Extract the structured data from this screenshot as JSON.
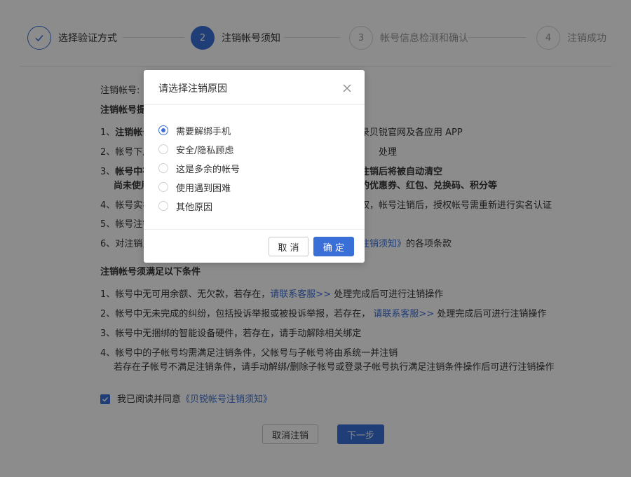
{
  "stepper": {
    "steps": [
      {
        "label": "选择验证方式"
      },
      {
        "number": "2",
        "label": "注销帐号须知"
      },
      {
        "number": "3",
        "label": "帐号信息检测和确认"
      },
      {
        "number": "4",
        "label": "注销成功"
      }
    ]
  },
  "account": {
    "label": "注销帐号:"
  },
  "section1": {
    "title": "注销帐号提",
    "items": [
      {
        "num": "1、",
        "bold": "注销帐号",
        "tail": "录贝锐官网及各应用 APP"
      },
      {
        "num": "2、",
        "text": "帐号下用",
        "tail": "处理"
      },
      {
        "num": "3、",
        "bold": "帐号中存",
        "tail_bold": "注销后将被自动清空",
        "line2": "尚未使用",
        "line2_tail": "的优惠券、红包、兑换码、积分等"
      },
      {
        "num": "4、",
        "text": "帐号实名",
        "tail": "权，帐号注销后，授权帐号需重新进行实名认证"
      },
      {
        "num": "5、",
        "text": "帐号注销"
      },
      {
        "num": "6、",
        "text": "对注销贝",
        "tail_link": "注销须知》",
        "tail": "的各项条款"
      }
    ]
  },
  "section2": {
    "title": "注销帐号须满足以下条件",
    "items": [
      {
        "num": "1、",
        "pre": "帐号中无可用余额、无欠款，若存在，",
        "link": "请联系客服>>",
        "post": " 处理完成后可进行注销操作"
      },
      {
        "num": "2、",
        "pre": "帐号中无未完成的纠纷，包括投诉举报或被投诉举报，若存在，",
        "link": " 请联系客服>>",
        "post": " 处理完成后可进行注销操作"
      },
      {
        "num": "3、",
        "pre": "帐号中无捆绑的智能设备硬件，若存在，请手动解除相关绑定"
      },
      {
        "num": "4、",
        "pre": "帐号中的子帐号均需满足注销条件，父帐号与子帐号将由系统一并注销",
        "line2": "若存在子帐号不满足注销条件，请手动解绑/删除子帐号或登录子帐号执行满足注销条件操作后可进行注销操作"
      }
    ]
  },
  "agreement": {
    "text": "我已阅读并同意",
    "link": "《贝锐帐号注销须知》",
    "checked": true
  },
  "footer": {
    "cancel": "取消注销",
    "next": "下一步"
  },
  "modal": {
    "title": "请选择注销原因",
    "options": [
      {
        "label": "需要解绑手机",
        "selected": true
      },
      {
        "label": "安全/隐私顾虑",
        "selected": false
      },
      {
        "label": "这是多余的帐号",
        "selected": false
      },
      {
        "label": "使用遇到困难",
        "selected": false
      },
      {
        "label": "其他原因",
        "selected": false
      }
    ],
    "cancel": "取 消",
    "confirm": "确 定"
  },
  "colors": {
    "accent": "#3a6fd8",
    "overlay": "rgba(0,0,0,0.45)"
  }
}
